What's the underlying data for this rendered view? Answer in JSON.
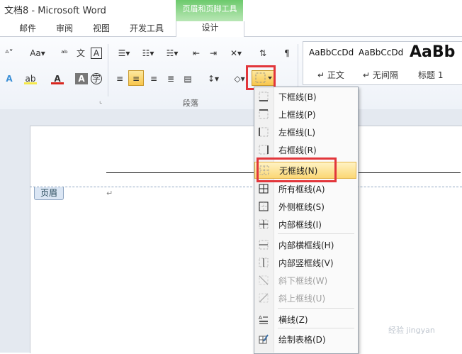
{
  "window": {
    "title": "文档8  -  Microsoft Word"
  },
  "tabs": [
    "邮件",
    "审阅",
    "视图",
    "开发工具"
  ],
  "context_tab": {
    "group_title": "页眉和页脚工具",
    "tab_label": "设计"
  },
  "ribbon": {
    "group_label": "段落",
    "styles": [
      {
        "preview": "AaBbCcDd",
        "name": "↵ 正文"
      },
      {
        "preview": "AaBbCcDd",
        "name": "↵ 无间隔"
      },
      {
        "preview": "AaBb",
        "name": "标题 1"
      }
    ]
  },
  "document": {
    "header_tag": "页眉",
    "paragraph_mark": "↵"
  },
  "border_menu": {
    "items": [
      {
        "label": "下框线(B)",
        "icon": "bottom-border-icon",
        "enabled": true
      },
      {
        "label": "上框线(P)",
        "icon": "top-border-icon",
        "enabled": true
      },
      {
        "label": "左框线(L)",
        "icon": "left-border-icon",
        "enabled": true
      },
      {
        "label": "右框线(R)",
        "icon": "right-border-icon",
        "enabled": true
      },
      {
        "label": "无框线(N)",
        "icon": "no-border-icon",
        "enabled": true,
        "selected": true
      },
      {
        "label": "所有框线(A)",
        "icon": "all-borders-icon",
        "enabled": true
      },
      {
        "label": "外侧框线(S)",
        "icon": "outside-borders-icon",
        "enabled": true
      },
      {
        "label": "内部框线(I)",
        "icon": "inside-borders-icon",
        "enabled": true
      },
      {
        "label": "内部横框线(H)",
        "icon": "inside-horizontal-border-icon",
        "enabled": true
      },
      {
        "label": "内部竖框线(V)",
        "icon": "inside-vertical-border-icon",
        "enabled": true
      },
      {
        "label": "斜下框线(W)",
        "icon": "diagonal-down-border-icon",
        "enabled": false
      },
      {
        "label": "斜上框线(U)",
        "icon": "diagonal-up-border-icon",
        "enabled": false
      },
      {
        "label": "横线(Z)",
        "icon": "horizontal-line-icon",
        "enabled": true
      },
      {
        "label": "绘制表格(D)",
        "icon": "draw-table-icon",
        "enabled": true
      }
    ]
  },
  "colors": {
    "highlight_box": "#e2363b",
    "selected_item": "#fbd775",
    "context_tab": "#6cc96c"
  },
  "watermark": "经验 jingyan"
}
